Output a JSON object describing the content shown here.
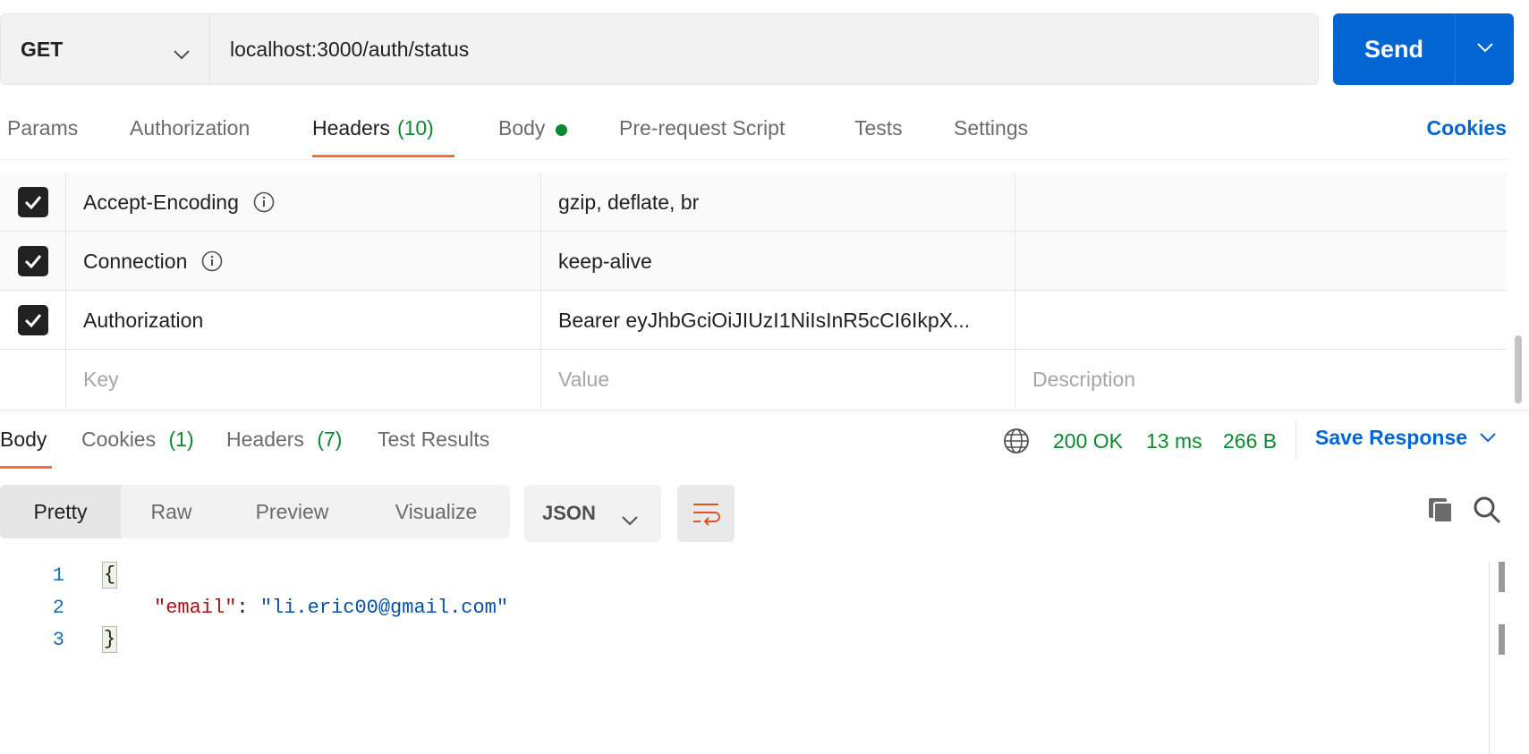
{
  "request": {
    "method": "GET",
    "url": "localhost:3000/auth/status",
    "send_label": "Send"
  },
  "request_tabs": [
    {
      "label": "Params"
    },
    {
      "label": "Authorization"
    },
    {
      "label": "Headers",
      "count": "(10)",
      "active": true
    },
    {
      "label": "Body",
      "has_content_dot": true
    },
    {
      "label": "Pre-request Script"
    },
    {
      "label": "Tests"
    },
    {
      "label": "Settings"
    }
  ],
  "cookies_link": "Cookies",
  "headers": {
    "rows": [
      {
        "checked": true,
        "key": "Accept-Encoding",
        "value": "gzip, deflate, br",
        "description": ""
      },
      {
        "checked": true,
        "key": "Connection",
        "value": "keep-alive",
        "description": ""
      },
      {
        "checked": true,
        "key": "Authorization",
        "value": "Bearer eyJhbGciOiJIUzI1NiIsInR5cCI6IkpX...",
        "description": ""
      }
    ],
    "placeholders": {
      "key": "Key",
      "value": "Value",
      "description": "Description"
    }
  },
  "response_tabs": [
    {
      "label": "Body",
      "active": true
    },
    {
      "label": "Cookies",
      "count": "(1)"
    },
    {
      "label": "Headers",
      "count": "(7)"
    },
    {
      "label": "Test Results"
    }
  ],
  "response_meta": {
    "status": "200 OK",
    "time": "13 ms",
    "size": "266 B",
    "save_label": "Save Response"
  },
  "view_modes": [
    {
      "label": "Pretty",
      "active": true
    },
    {
      "label": "Raw"
    },
    {
      "label": "Preview"
    },
    {
      "label": "Visualize"
    }
  ],
  "format": "JSON",
  "body_lines": [
    {
      "number": "1",
      "text": "{"
    },
    {
      "number": "2",
      "key": "\"email\"",
      "sep": ": ",
      "value": "\"li.eric00@gmail.com\""
    },
    {
      "number": "3",
      "text": "}"
    }
  ],
  "colors": {
    "send": "#0265d2",
    "accent_tab": "#ff6c37",
    "success": "#0a8a2e",
    "link": "#0265d2"
  },
  "icons": [
    "chevron-down-icon",
    "info-icon",
    "check-icon",
    "globe-icon",
    "wrap-lines-icon",
    "copy-icon",
    "search-icon"
  ]
}
